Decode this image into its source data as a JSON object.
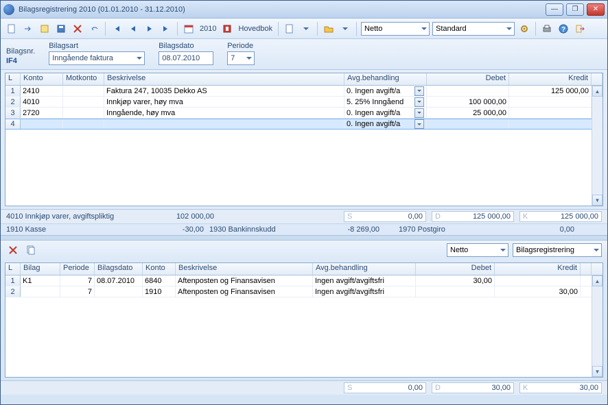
{
  "window": {
    "title": "Bilagsregistrering 2010 (01.01.2010 - 31.12.2010)"
  },
  "toolbar": {
    "year": "2010",
    "hovedbok": "Hovedbok",
    "netto": "Netto",
    "standard": "Standard"
  },
  "form": {
    "labels": {
      "bilagsnr": "Bilagsnr.",
      "bilagsart": "Bilagsart",
      "bilagsdato": "Bilagsdato",
      "periode": "Periode"
    },
    "bilagsnr": "IF4",
    "bilagsart": "Inngående faktura",
    "bilagsdato": "08.07.2010",
    "periode": "7"
  },
  "topGrid": {
    "headers": {
      "l": "L",
      "konto": "Konto",
      "motkonto": "Motkonto",
      "beskrivelse": "Beskrivelse",
      "avg": "Avg.behandling",
      "debet": "Debet",
      "kredit": "Kredit"
    },
    "rows": [
      {
        "n": "1",
        "konto": "2410",
        "mot": "",
        "besk": "Faktura 247, 10035 Dekko AS",
        "avg": "0. Ingen avgift/a",
        "debet": "",
        "kredit": "125 000,00"
      },
      {
        "n": "2",
        "konto": "4010",
        "mot": "",
        "besk": "Innkjøp varer, høy mva",
        "avg": "5. 25% Inngåend",
        "debet": "100 000,00",
        "kredit": ""
      },
      {
        "n": "3",
        "konto": "2720",
        "mot": "",
        "besk": "Inngående, høy mva",
        "avg": "0. Ingen avgift/a",
        "debet": "25 000,00",
        "kredit": ""
      },
      {
        "n": "4",
        "konto": "",
        "mot": "",
        "besk": "",
        "avg": "0. Ingen avgift/a",
        "debet": "",
        "kredit": ""
      }
    ]
  },
  "summary1": {
    "kontoLine": "4010 Innkjøp varer, avgiftspliktig",
    "kontoVal": "102 000,00",
    "s": "0,00",
    "d": "125 000,00",
    "k": "125 000,00"
  },
  "balance": {
    "a1": "1910 Kasse",
    "v1": "-30,00",
    "a2": "1930 Bankinnskudd",
    "v2": "-8 269,00",
    "a3": "1970 Postgiro",
    "v3": "0,00"
  },
  "bottomBar": {
    "netto": "Netto",
    "mode": "Bilagsregistrering"
  },
  "botGrid": {
    "headers": {
      "l": "L",
      "bilag": "Bilag",
      "periode": "Periode",
      "bilagsdato": "Bilagsdato",
      "konto": "Konto",
      "beskrivelse": "Beskrivelse",
      "avg": "Avg.behandling",
      "debet": "Debet",
      "kredit": "Kredit"
    },
    "rows": [
      {
        "n": "1",
        "bilag": "K1",
        "per": "7",
        "dato": "08.07.2010",
        "konto": "6840",
        "besk": "Aftenposten og Finansavisen",
        "avg": "Ingen avgift/avgiftsfri",
        "debet": "30,00",
        "kredit": ""
      },
      {
        "n": "2",
        "bilag": "",
        "per": "7",
        "dato": "",
        "konto": "1910",
        "besk": "Aftenposten og Finansavisen",
        "avg": "Ingen avgift/avgiftsfri",
        "debet": "",
        "kredit": "30,00"
      }
    ]
  },
  "summary2": {
    "s": "0,00",
    "d": "30,00",
    "k": "30,00"
  }
}
